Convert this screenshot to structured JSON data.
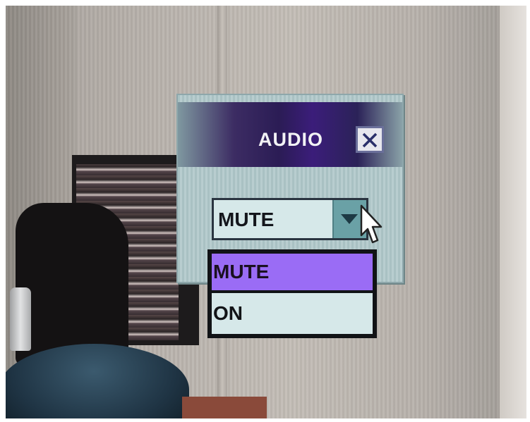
{
  "dialog": {
    "title": "AUDIO",
    "close_label": "X"
  },
  "select": {
    "value": "MUTE",
    "options": [
      "MUTE",
      "ON"
    ],
    "selected_index": 0
  },
  "icons": {
    "close": "close-icon",
    "dropdown": "chevron-down-icon",
    "pointer": "cursor-icon"
  },
  "colors": {
    "titlebar": "#2b1c55",
    "selected_option": "#9a6cf5",
    "panel": "#b8cdcf",
    "field": "#d6e8e9"
  }
}
